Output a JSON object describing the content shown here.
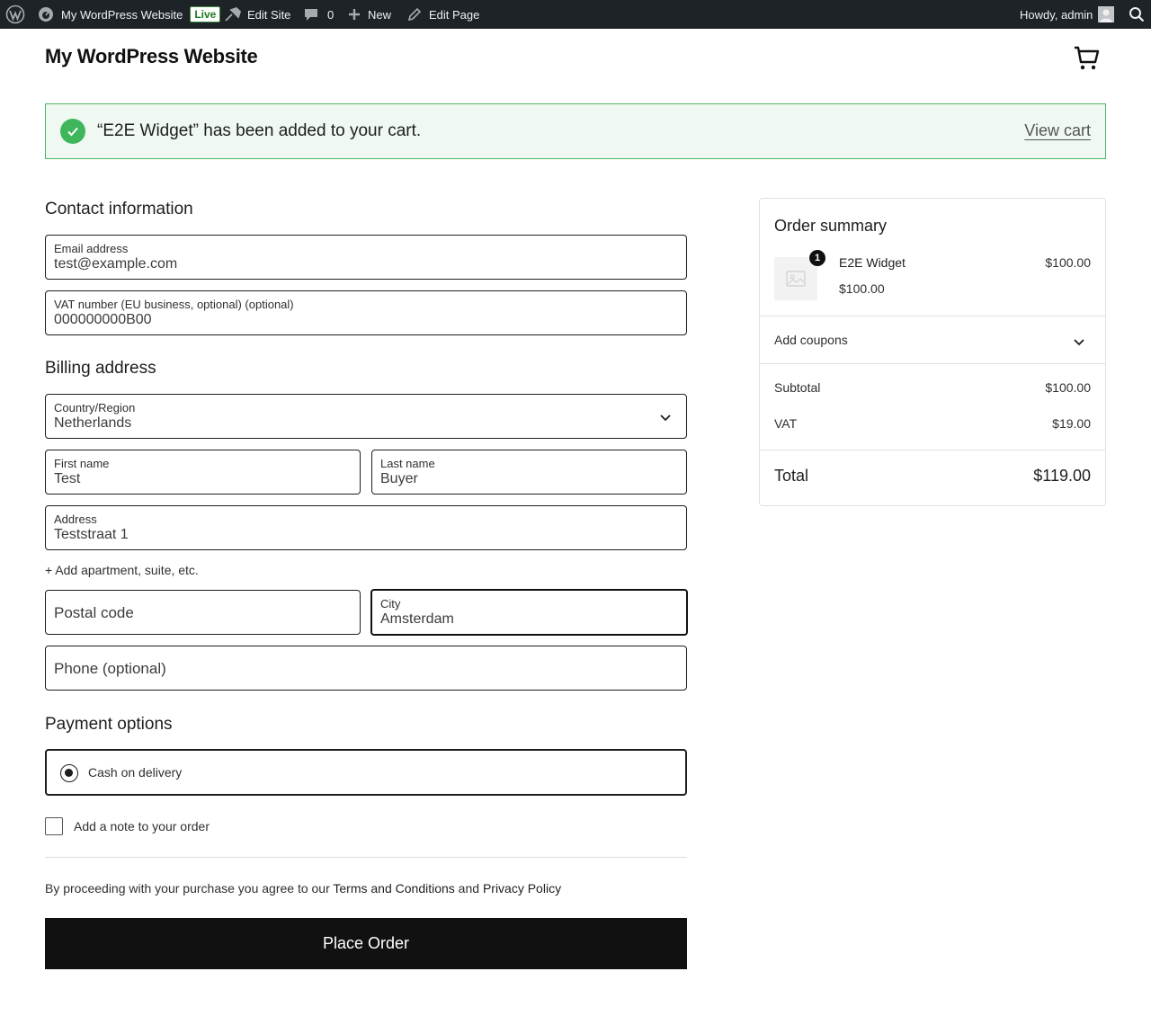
{
  "adminbar": {
    "site_name": "My WordPress Website",
    "live_badge": "Live",
    "edit_site": "Edit Site",
    "comments_count": "0",
    "new_label": "New",
    "edit_page": "Edit Page",
    "howdy": "Howdy, admin"
  },
  "header": {
    "site_title": "My WordPress Website"
  },
  "notice": {
    "message": "“E2E Widget” has been added to your cart.",
    "view_cart": "View cart"
  },
  "contact": {
    "heading": "Contact information",
    "email_label": "Email address",
    "email_value": "test@example.com",
    "vat_label": "VAT number (EU business, optional) (optional)",
    "vat_value": "000000000B00"
  },
  "billing": {
    "heading": "Billing address",
    "country_label": "Country/Region",
    "country_value": "Netherlands",
    "first_name_label": "First name",
    "first_name_value": "Test",
    "last_name_label": "Last name",
    "last_name_value": "Buyer",
    "address_label": "Address",
    "address_value": "Teststraat 1",
    "add_apartment": "+ Add apartment, suite, etc.",
    "postal_placeholder": "Postal code",
    "city_label": "City",
    "city_value": "Amsterdam",
    "phone_placeholder": "Phone (optional)"
  },
  "payment": {
    "heading": "Payment options",
    "option_label": "Cash on delivery"
  },
  "note": {
    "label": "Add a note to your order"
  },
  "terms": {
    "prefix": "By proceeding with your purchase you agree to our ",
    "terms_link": "Terms and Conditions",
    "and": " and ",
    "privacy_link": "Privacy Policy"
  },
  "place_order": "Place Order",
  "summary": {
    "title": "Order summary",
    "item_name": "E2E Widget",
    "item_qty": "1",
    "item_price": "$100.00",
    "item_unit_price": "$100.00",
    "coupons": "Add coupons",
    "subtotal_label": "Subtotal",
    "subtotal_value": "$100.00",
    "vat_label": "VAT",
    "vat_value": "$19.00",
    "total_label": "Total",
    "total_value": "$119.00"
  },
  "colors": {
    "admin_bar": "#1d2327",
    "notice_border": "#4ab866",
    "notice_bg": "#eff9f1",
    "check": "#3fb65c",
    "button": "#111111"
  },
  "icons": [
    "wordpress-icon",
    "dashboard-icon",
    "edit-site-icon",
    "comment-icon",
    "plus-icon",
    "pencil-icon",
    "avatar",
    "search-icon",
    "cart-icon",
    "check-icon",
    "chevron-down-icon",
    "image-placeholder-icon"
  ]
}
